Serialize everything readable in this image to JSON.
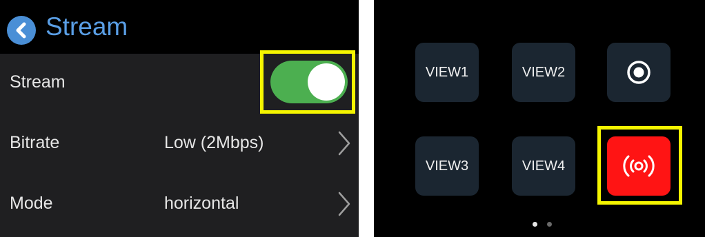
{
  "header": {
    "title": "Stream"
  },
  "settings": {
    "stream": {
      "label": "Stream",
      "enabled": true,
      "toggle_color": "#4caf50"
    },
    "bitrate": {
      "label": "Bitrate",
      "value": "Low (2Mbps)"
    },
    "mode": {
      "label": "Mode",
      "value": "horizontal"
    }
  },
  "remote": {
    "tiles": [
      {
        "label": "VIEW1"
      },
      {
        "label": "VIEW2"
      },
      {
        "icon": "record-icon"
      },
      {
        "label": "VIEW3"
      },
      {
        "label": "VIEW4"
      },
      {
        "icon": "broadcast-icon",
        "color": "#ff1414"
      }
    ],
    "page_dots": {
      "count": 2,
      "active": 1
    }
  },
  "highlight_color": "#f5f500"
}
